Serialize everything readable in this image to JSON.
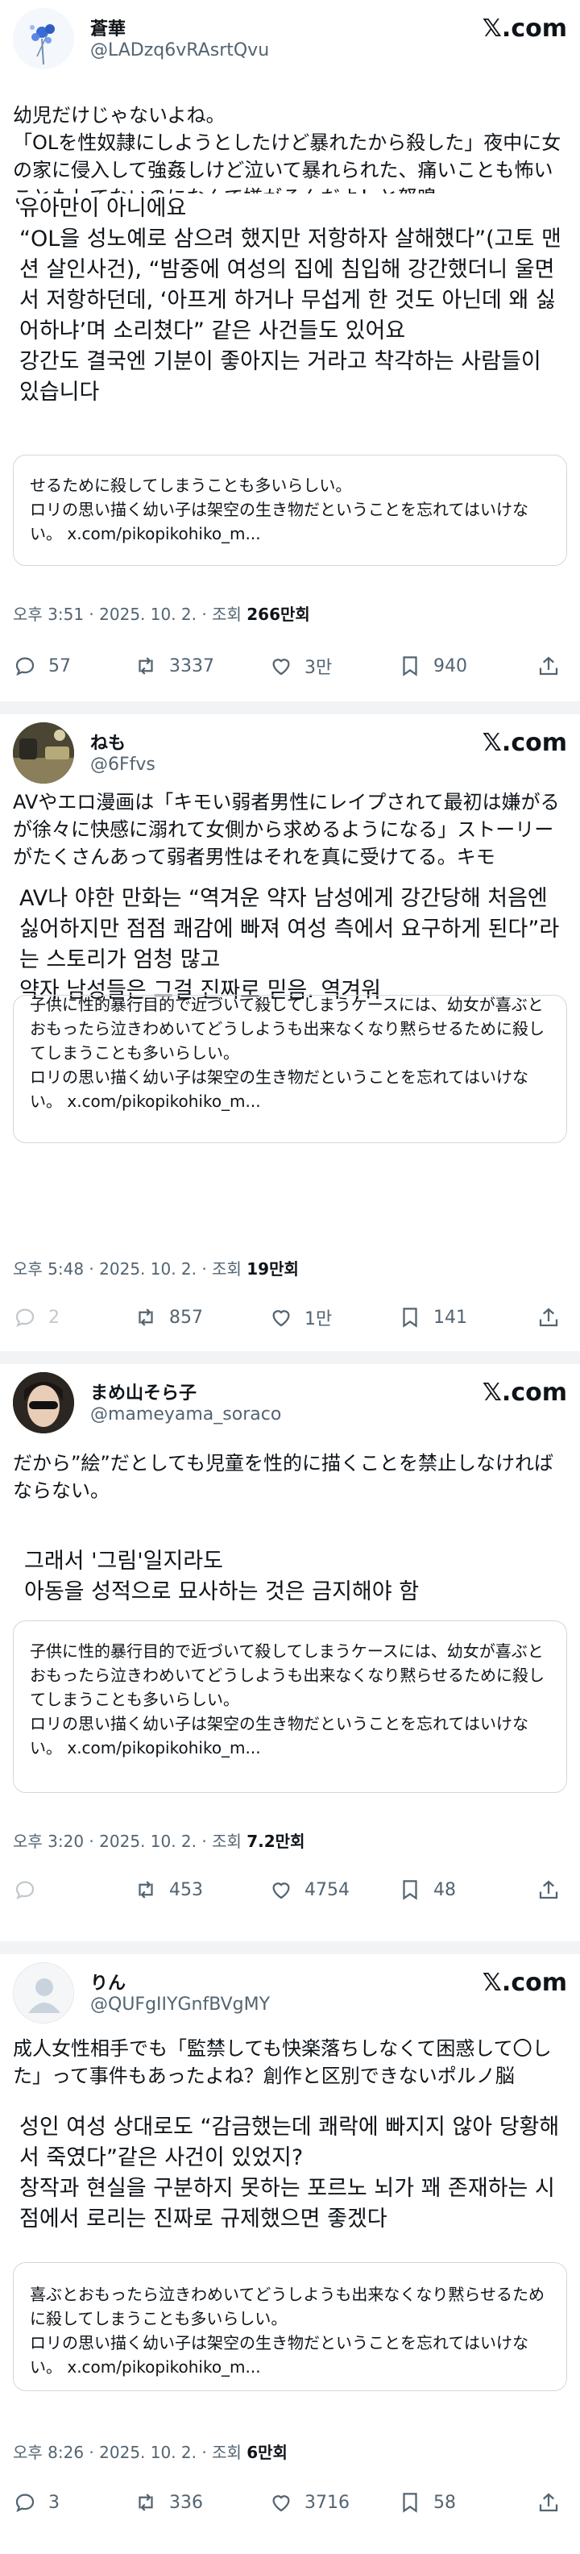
{
  "brand": "𝕏.com",
  "posts": [
    {
      "name": "蒼華",
      "handle": "@LADzq6vRAsrtQvu",
      "text": "幼児だけじゃないよね。\n「OLを性奴隷にしようとしたけど暴れたから殺した」夜中に女の家に侵入して強姦しけど泣いて暴れられた、痛いことも怖いこともしてないのになんで嫌がるんだよ！と怒鳴っ",
      "translation": "유아만이 아니에요\n“OL을 성노예로 삼으려 했지만 저항하자 살해했다”(고토 맨션 살인사건), “밤중에 여성의 집에 침입해 강간했더니 울면서 저항하던데, ‘아프게 하거나 무섭게 한 것도 아닌데 왜 싫어하냐’며 소리쳤다” 같은 사건들도 있어요\n강간도 결국엔 기분이 좋아지는 거라고 착각하는 사람들이 있습니다",
      "quote": "せるために殺してしまうことも多いらしい。\nロリの思い描く幼い子は架空の生き物だということを忘れてはいけない。 x.com/pikopikohiko_m...",
      "time": "오후 3:51 · 2025. 10. 2. · 조회 ",
      "views": "266만회",
      "replies": "57",
      "reposts": "3337",
      "likes": "3만",
      "bookmarks": "940"
    },
    {
      "name": "ねも",
      "handle": "@6Ffvs",
      "text": "AVやエロ漫画は「キモい弱者男性にレイプされて最初は嫌がるが徐々に快感に溺れて女側から求めるようになる」ストーリーがたくさんあって弱者男性はそれを真に受けてる。キモ",
      "translation": "AV나 야한 만화는 “역겨운 약자 남성에게 강간당해 처음엔 싫어하지만 점점 쾌감에 빠져 여성 측에서 요구하게 된다”라는 스토리가 엄청 많고\n약자 남성들은 그걸 진짜로 믿음. 역겨워",
      "quote": "子供に性的暴行目的で近づいて殺してしまうケースには、幼女が喜ぶとおもったら泣きわめいてどうしようも出来なくなり黙らせるために殺してしまうことも多いらしい。\nロリの思い描く幼い子は架空の生き物だということを忘れてはいけない。 x.com/pikopikohiko_m...",
      "time": "오후 5:48 · 2025. 10. 2. · 조회 ",
      "views": "19만회",
      "replies": "2",
      "reposts": "857",
      "likes": "1만",
      "bookmarks": "141"
    },
    {
      "name": "まめ山そら子",
      "handle": "@mameyama_soraco",
      "text": "だから”絵”だとしても児童を性的に描くことを禁止しなければならない。",
      "translation": "그래서 '그림'일지라도\n아동을 성적으로 묘사하는 것은 금지해야 함",
      "quote": "子供に性的暴行目的で近づいて殺してしまうケースには、幼女が喜ぶとおもったら泣きわめいてどうしようも出来なくなり黙らせるために殺してしまうことも多いらしい。\nロリの思い描く幼い子は架空の生き物だということを忘れてはいけない。 x.com/pikopikohiko_m...",
      "time": "오후 3:20 · 2025. 10. 2. · 조회 ",
      "views": "7.2만회",
      "replies": "",
      "reposts": "453",
      "likes": "4754",
      "bookmarks": "48"
    },
    {
      "name": "りん",
      "handle": "@QUFgIIYGnfBVgMY",
      "text": "成人女性相手でも「監禁しても快楽落ちしなくて困惑して〇した」って事件もあったよね？創作と区別できないポルノ脳",
      "translation": "성인 여성 상대로도 “감금했는데 쾌락에 빠지지 않아 당황해서 죽였다”같은 사건이 있었지?\n창작과 현실을 구분하지 못하는 포르노 뇌가 꽤 존재하는 시점에서 로리는 진짜로 규제했으면 좋겠다",
      "quote": "喜ぶとおもったら泣きわめいてどうしようも出来なくなり黙らせるために殺してしまうことも多いらしい。\nロリの思い描く幼い子は架空の生き物だということを忘れてはいけない。 x.com/pikopikohiko_m...",
      "time": "오후 8:26 · 2025. 10. 2. · 조회 ",
      "views": "6만회",
      "replies": "3",
      "reposts": "336",
      "likes": "3716",
      "bookmarks": "58"
    }
  ]
}
